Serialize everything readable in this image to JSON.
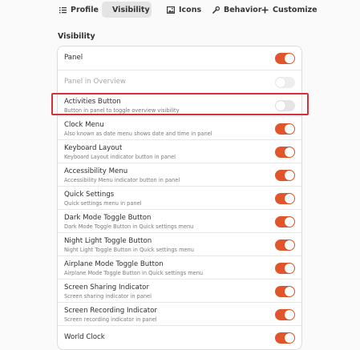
{
  "tabs": [
    {
      "label": "Profile",
      "icon": "list-icon",
      "active": false
    },
    {
      "label": "Visibility",
      "icon": "gear-icon",
      "active": true
    },
    {
      "label": "Icons",
      "icon": "image-icon",
      "active": false
    },
    {
      "label": "Behavior",
      "icon": "wrench-icon",
      "active": false
    },
    {
      "label": "Customize",
      "icon": "plus-icon",
      "active": false
    }
  ],
  "section_title": "Visibility",
  "colors": {
    "accent": "#e2552a",
    "highlight": "#d2333a"
  },
  "rows": [
    {
      "title": "Panel",
      "subtitle": "",
      "state": "on",
      "enabled": true
    },
    {
      "title": "Panel in Overview",
      "subtitle": "",
      "state": "off",
      "enabled": false
    },
    {
      "title": "Activities Button",
      "subtitle": "Button in panel to toggle overview visibility",
      "state": "off",
      "enabled": true
    },
    {
      "title": "Clock Menu",
      "subtitle": "Also known as date menu shows date and time in panel",
      "state": "on",
      "enabled": true
    },
    {
      "title": "Keyboard Layout",
      "subtitle": "Keyboard Layout indicator button in panel",
      "state": "on",
      "enabled": true
    },
    {
      "title": "Accessibility Menu",
      "subtitle": "Accessibility Menu indicator button in panel",
      "state": "on",
      "enabled": true
    },
    {
      "title": "Quick Settings",
      "subtitle": "Quick settings menu in panel",
      "state": "on",
      "enabled": true
    },
    {
      "title": "Dark Mode Toggle Button",
      "subtitle": "Dark Mode Toggle Button in Quick settings menu",
      "state": "on",
      "enabled": true
    },
    {
      "title": "Night Light Toggle Button",
      "subtitle": "Night Light Toggle Button in Quick settings menu",
      "state": "on",
      "enabled": true
    },
    {
      "title": "Airplane Mode Toggle Button",
      "subtitle": "Airplane Mode Toggle Button in Quick settings menu",
      "state": "on",
      "enabled": true
    },
    {
      "title": "Screen Sharing Indicator",
      "subtitle": "Screen sharing indicator in panel",
      "state": "on",
      "enabled": true
    },
    {
      "title": "Screen Recording Indicator",
      "subtitle": "Screen recording indicator in panel",
      "state": "on",
      "enabled": true
    },
    {
      "title": "World Clock",
      "subtitle": "",
      "state": "on",
      "enabled": true
    }
  ]
}
